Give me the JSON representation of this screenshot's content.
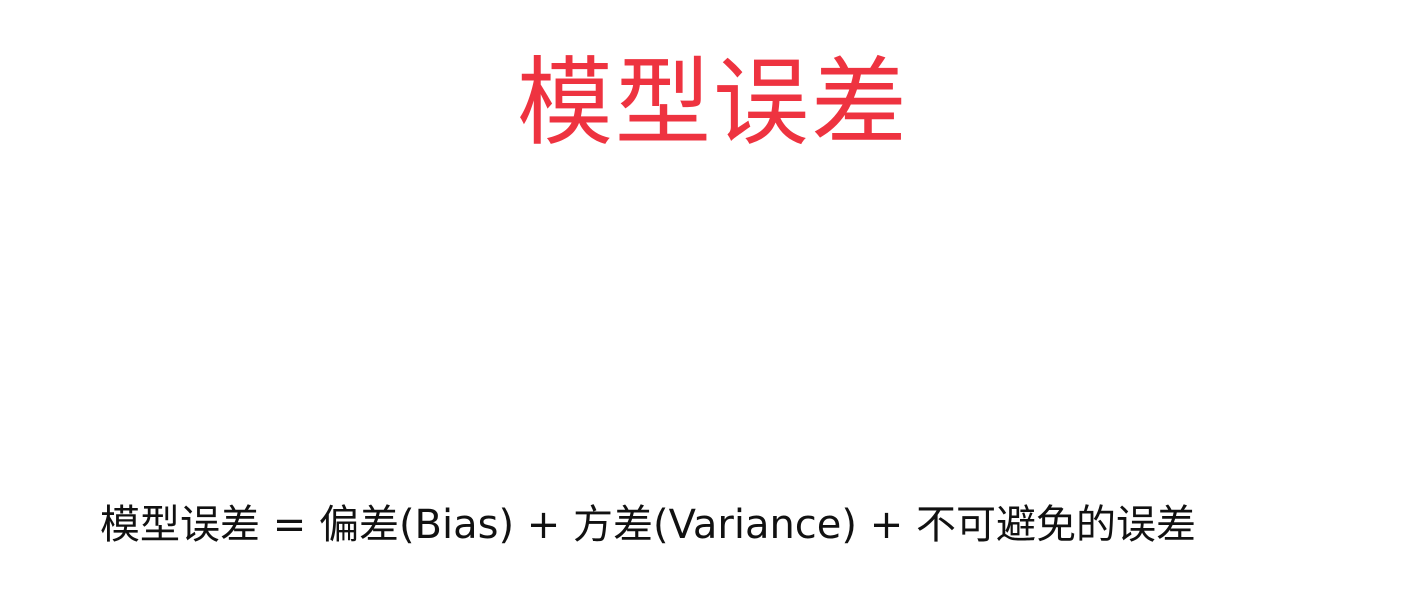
{
  "slide": {
    "title": "模型误差",
    "formula": "模型误差 = 偏差(Bias) + 方差(Variance) + 不可避免的误差"
  }
}
